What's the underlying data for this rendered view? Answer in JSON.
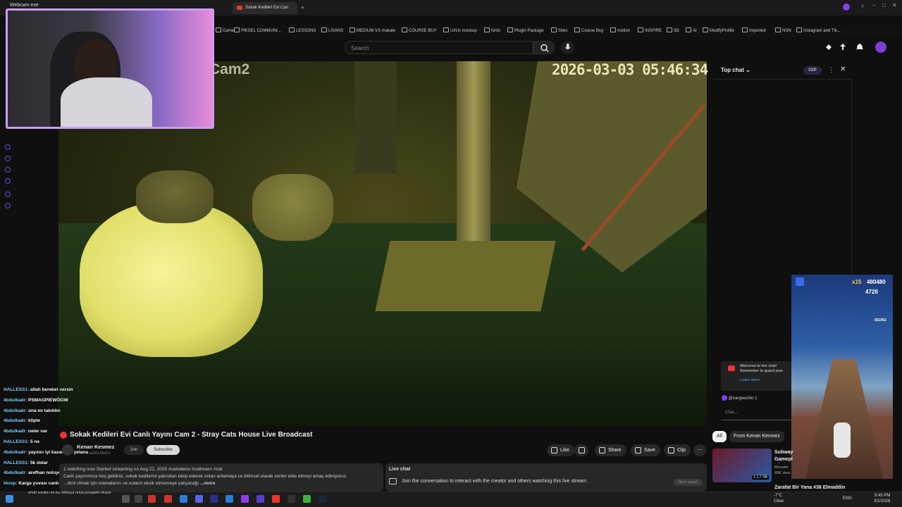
{
  "browser": {
    "active_tab": "Sokak Kedileri Evi Can",
    "bookmarks": [
      "Game",
      "PİKSEL COMMUNI...",
      "LESSONS",
      "LİSANS",
      "MEDIUM VS makale",
      "COURSE BUY",
      "UI/Ux mockup",
      "fonts",
      "Plugin Package",
      "Sites",
      "Course Buy",
      "motion",
      "INSPIRE",
      "3D",
      "AI",
      "ModifyProfile",
      "Imported",
      "NSN",
      "Instagram and Tik..."
    ]
  },
  "youtube": {
    "search_placeholder": "Search"
  },
  "webcam": {
    "title": "Webcam.exe"
  },
  "video": {
    "cam_label": "Cam2",
    "timestamp": "2026-03-03 05:46:34"
  },
  "chat": {
    "header": "Top chat",
    "xp": "0XP",
    "welcome_text": "Welcome to live chat! Remember to guard your privacy and abide by our community",
    "learn_more": "Learn more",
    "user": "@nargeeshio",
    "user_count": "1",
    "input_placeholder": "Chat..."
  },
  "game": {
    "multiplier": "x15",
    "score": "480480",
    "coins": "4728",
    "hiscore": "651953"
  },
  "video_info": {
    "title": "Sokak Kedileri Evi Canlı Yayını Cam 2 - Stray Cats House Live Broadcast",
    "channel": "Kenan Kesmez",
    "subs": "subscribers",
    "join": "Join",
    "subscribe": "Subscribe",
    "description_meta": "1 watching now  Started streaming on Aug 22, 2025  #catvideos #catlovers #cat",
    "description": "Canlı yayınımıza hoş geldiniz, sokak kedilerini yakından takip ederek onlan anlamaya ve bilimsel olarak veriler elde etmeyi amaç ediniyoruz.",
    "description2": "...dimi olmak için mamalarını ve suların eksik etmemeye çalışacağı",
    "more": "...more"
  },
  "actions": {
    "like": "Like",
    "share": "Share",
    "save": "Save",
    "clip": "Clip"
  },
  "livechat_panel": {
    "title": "Live chat",
    "text": "Join the conversation to interact with the creator and others watching this live stream.",
    "open_panel": "Open panel"
  },
  "filters": {
    "all": "All",
    "channel": "From Kenan Kesmez"
  },
  "related": {
    "title": "Subway",
    "title2": "Gamepl",
    "meta1": "Monster",
    "meta2": "89K view",
    "duration": "1:17:06",
    "title_next": "Zarafat Bir Yana #38 Elmaddin"
  },
  "stream_chat": [
    {
      "user": "HALLESS1:",
      "msg": "allah bereket versin"
    },
    {
      "user": "4bdulkadr:",
      "msg": "PSMAGPIEWÖGW"
    },
    {
      "user": "4bdulkadr:",
      "msg": "ona mı takıldın"
    },
    {
      "user": "4bdulkadr:",
      "msg": "kliptе"
    },
    {
      "user": "4bdulkadr:",
      "msg": "neler var"
    },
    {
      "user": "HALLESS1:",
      "msg": "5 ne"
    },
    {
      "user": "4bdulkadr:",
      "msg": "yayıncı iyi kazanıyor yelana"
    },
    {
      "user": "HALLESS1:",
      "msg": "5k dolar"
    },
    {
      "user": "4bdulkadr:",
      "msg": "arefhan noluyor"
    },
    {
      "user": "kkrep:",
      "msg": "Karga yuvası canlı yayını chatteki sohbete bak"
    },
    {
      "user": "",
      "msg": "efekt verdim mi bu videoya nova prospekt oluyor"
    }
  ],
  "taskbar": {
    "weather_temp": "-7°C",
    "weather_desc": "Clear",
    "lang": "ENG",
    "time": "9:45 PM",
    "date": "3/2/2026"
  },
  "colors": {
    "accent": "#c89ef5",
    "youtube_red": "#ff0033",
    "link": "#3ea6ff"
  }
}
